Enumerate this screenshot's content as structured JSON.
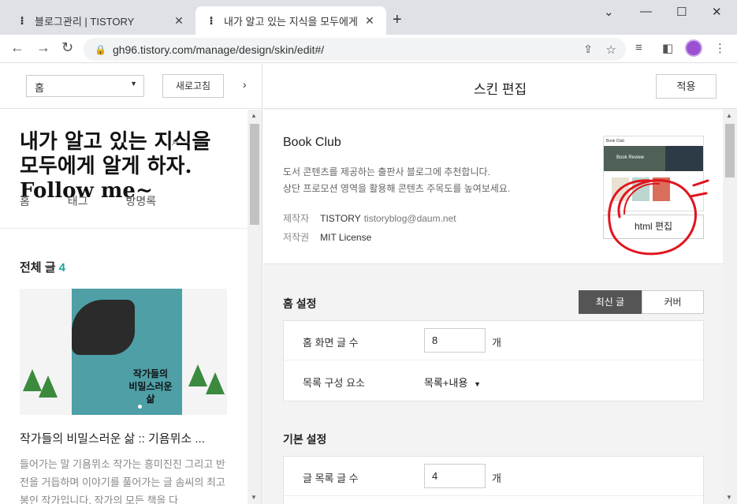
{
  "browser": {
    "tabs": [
      {
        "title": "블로그관리 | TISTORY",
        "active": false
      },
      {
        "title": "내가 알고 있는 지식을 모두에게",
        "active": true
      }
    ],
    "url": "gh96.tistory.com/manage/design/skin/edit#/"
  },
  "left": {
    "page_select": "홈",
    "refresh_label": "새로고침",
    "collapse_icon": "›",
    "blog_title": "내가 알고 있는 지식을 모두에게 알게 하자. Follow me~",
    "menu": [
      "홈",
      "태그",
      "방명록"
    ],
    "all_posts_label": "전체 글",
    "all_posts_count": "4",
    "book_cover_title": "작가들의 비밀스러운 삶",
    "post_title": "작가들의 비밀스러운 삶 :: 기욤뮈소 ...",
    "post_excerpt": "들어가는 말 기욤뮈소 작가는 흥미진진 그리고 반전을 거듭하며 이야기를 풀어가는 글 솜씨의 최고봉인 작가입니다. 작가의 모든 책을 다"
  },
  "right": {
    "header_title": "스킨 편집",
    "apply_label": "적용",
    "skin": {
      "name": "Book Club",
      "desc_line1": "도서 콘텐츠를 제공하는 출판사 블로그에 추천합니다.",
      "desc_line2": "상단 프로모션 영역을 활용해 콘텐츠 주목도를 높여보세요.",
      "maker_label": "제작자",
      "maker": "TISTORY",
      "maker_email": "tistoryblog@daum.net",
      "license_label": "저작권",
      "license": "MIT License",
      "html_edit_label": "html 편집",
      "thumb_brand": "Book Club",
      "thumb_banner": "Book Review"
    },
    "home_settings": {
      "title": "홈 설정",
      "seg_on": "최신 글",
      "seg_off": "커버",
      "rows": [
        {
          "label": "홈 화면 글 수",
          "value": "8",
          "unit": "개"
        },
        {
          "label": "목록 구성 요소",
          "value": "목록+내용"
        }
      ]
    },
    "basic_settings": {
      "title": "기본 설정",
      "rows": [
        {
          "label": "글 목록 글 수",
          "value": "4",
          "unit": "개"
        }
      ]
    }
  },
  "colors": {
    "accent_teal": "#1fa39b",
    "annotation_red": "#e0141e"
  }
}
